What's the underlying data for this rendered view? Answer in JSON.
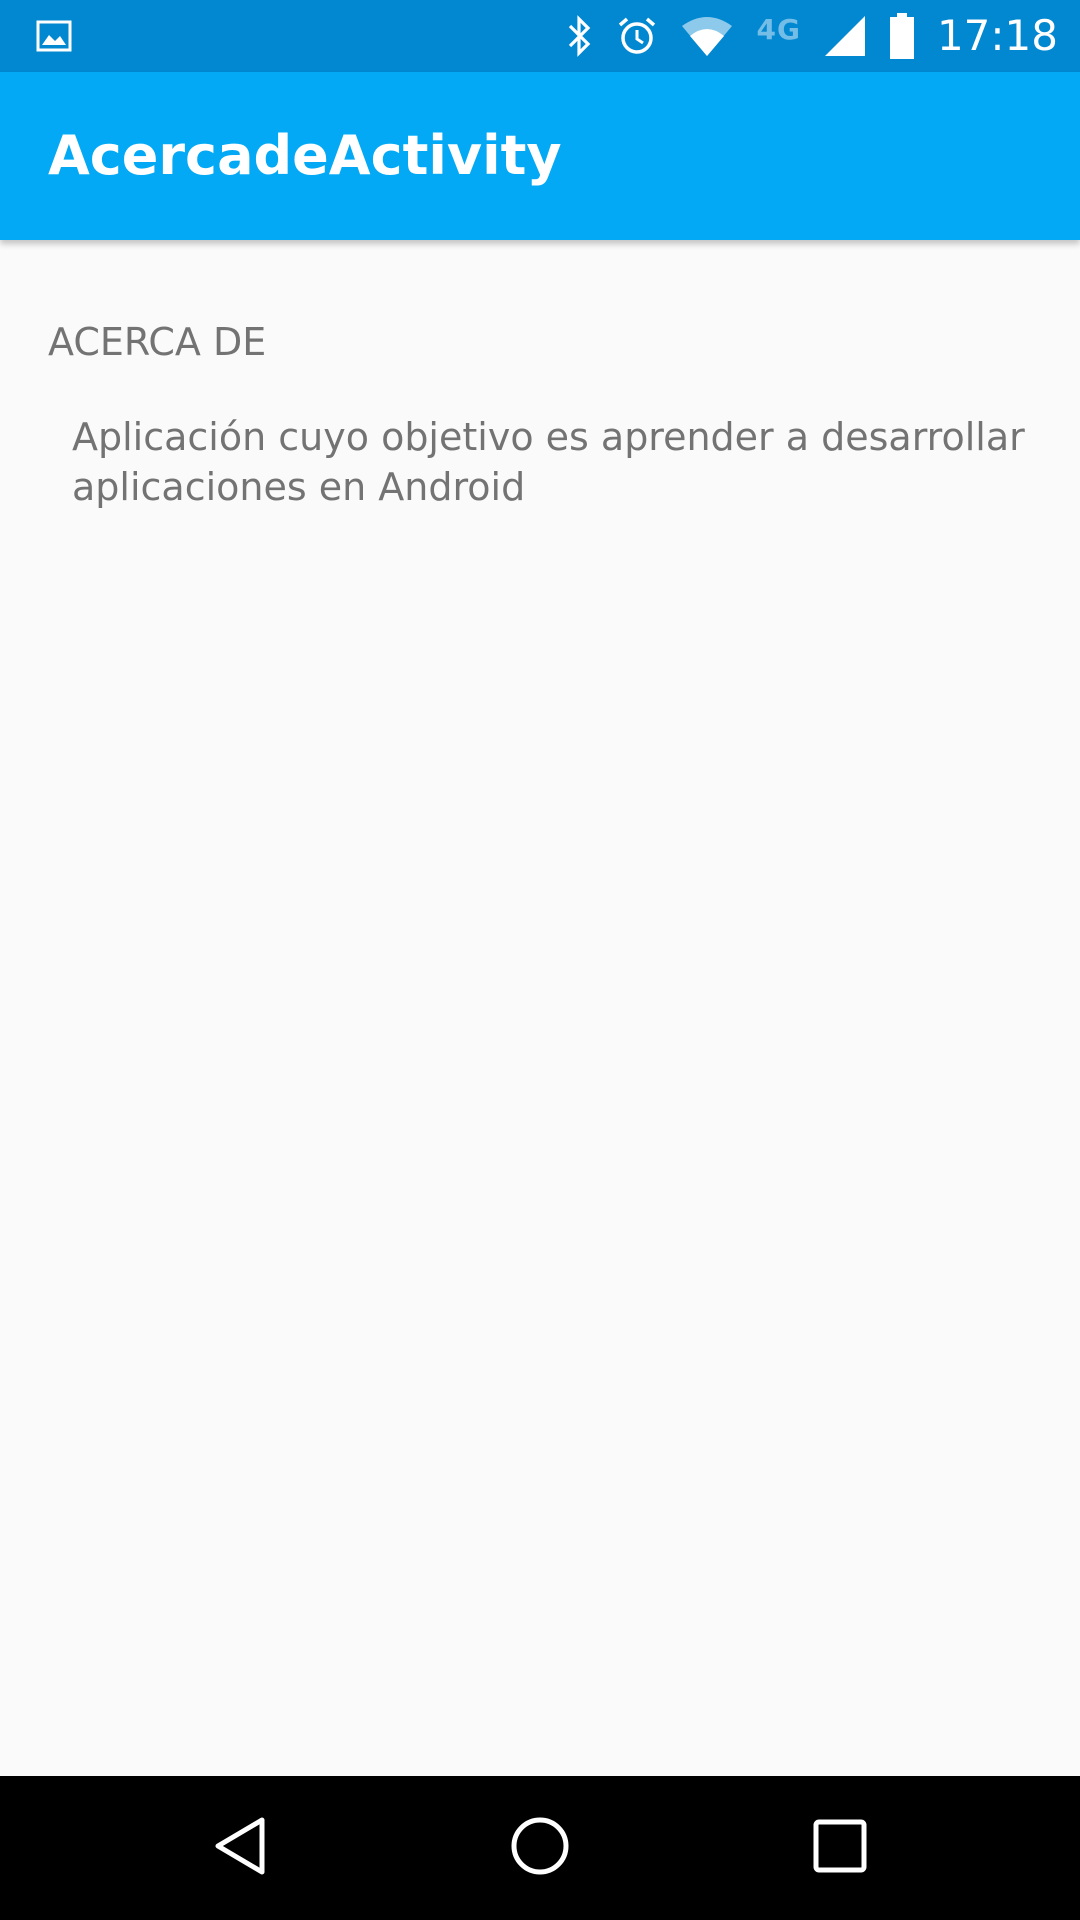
{
  "status_bar": {
    "left_icon": "image-notification-icon",
    "icons": [
      "bluetooth-icon",
      "alarm-icon",
      "wifi-icon",
      "signal-icon",
      "battery-icon"
    ],
    "network_label": "4G",
    "time": "17:18",
    "color": "#0288d1"
  },
  "app_bar": {
    "title": "AcercadeActivity",
    "color": "#03a9f4"
  },
  "content": {
    "section_header": "ACERCA DE",
    "section_body": "Aplicación cuyo objetivo es aprender a desarrollar aplicaciones en Android"
  },
  "nav_bar": {
    "buttons": [
      "back-icon",
      "home-icon",
      "recents-icon"
    ]
  }
}
